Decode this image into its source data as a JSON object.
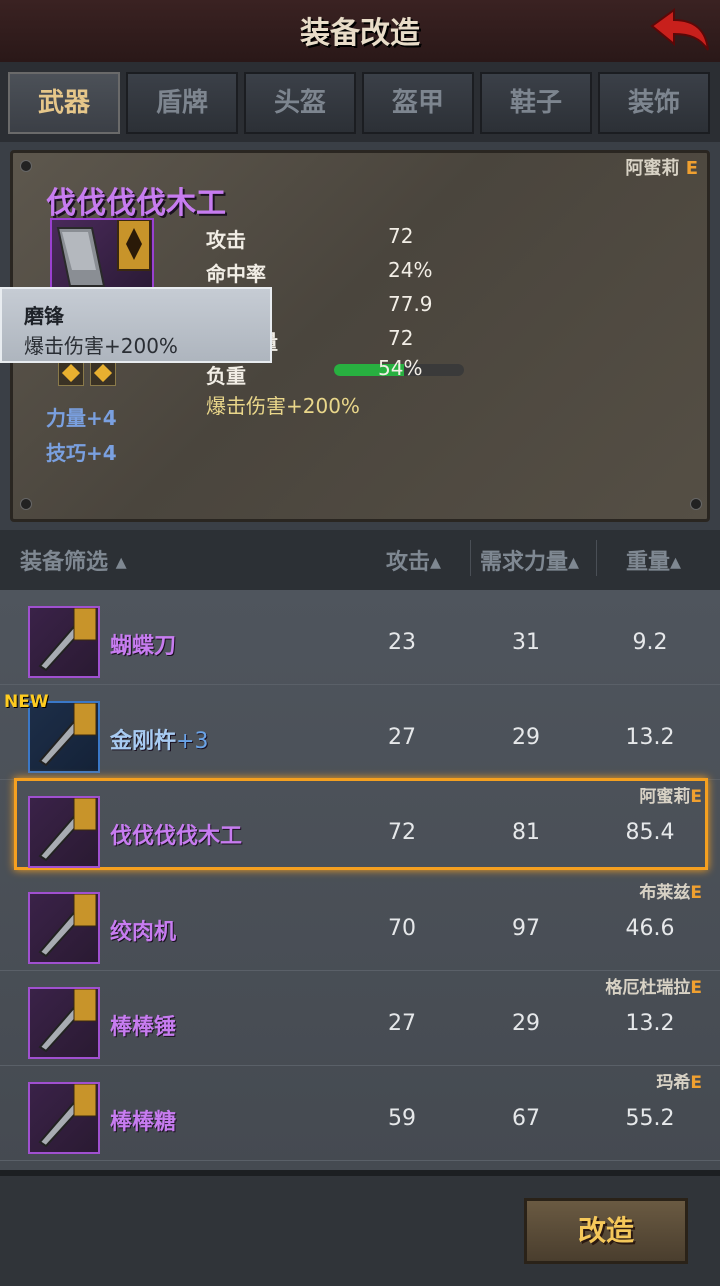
{
  "title": "装备改造",
  "tabs": [
    "武器",
    "盾牌",
    "头盔",
    "盔甲",
    "鞋子",
    "装饰"
  ],
  "active_tab": 0,
  "detail": {
    "owner": "阿蜜莉",
    "grade": "E",
    "name": "伐伐伐伐木工",
    "stats": [
      {
        "label": "攻击",
        "value": "72"
      },
      {
        "label": "命中率",
        "value": "24%"
      },
      {
        "label": "",
        "value": "77.9"
      },
      {
        "label": "量",
        "value": "72"
      },
      {
        "label": "负重",
        "value": "54%"
      }
    ],
    "weight_fraction": 0.54,
    "extra": "爆击伤害+200%",
    "bonus_str": "力量+4",
    "bonus_skill": "技巧+4"
  },
  "tooltip": {
    "title": "磨锋",
    "desc": "爆击伤害+200%"
  },
  "list_header": {
    "filter": "装备筛选",
    "atk": "攻击",
    "req": "需求力量",
    "weight": "重量"
  },
  "items": [
    {
      "name": "蝴蝶刀",
      "plus": "",
      "atk": "23",
      "req": "31",
      "weight": "9.2",
      "owner": "",
      "grade": "",
      "tier": "purple",
      "is_new": false,
      "selected": false
    },
    {
      "name": "金刚杵",
      "plus": "+3",
      "atk": "27",
      "req": "29",
      "weight": "13.2",
      "owner": "",
      "grade": "",
      "tier": "blue",
      "is_new": true,
      "selected": false
    },
    {
      "name": "伐伐伐伐木工",
      "plus": "",
      "atk": "72",
      "req": "81",
      "weight": "85.4",
      "owner": "阿蜜莉",
      "grade": "E",
      "tier": "purple",
      "is_new": false,
      "selected": true
    },
    {
      "name": "绞肉机",
      "plus": "",
      "atk": "70",
      "req": "97",
      "weight": "46.6",
      "owner": "布莱兹",
      "grade": "E",
      "tier": "purple",
      "is_new": false,
      "selected": false
    },
    {
      "name": "棒棒锤",
      "plus": "",
      "atk": "27",
      "req": "29",
      "weight": "13.2",
      "owner": "格厄杜瑞拉",
      "grade": "E",
      "tier": "purple",
      "is_new": false,
      "selected": false
    },
    {
      "name": "棒棒糖",
      "plus": "",
      "atk": "59",
      "req": "67",
      "weight": "55.2",
      "owner": "玛希",
      "grade": "E",
      "tier": "purple",
      "is_new": false,
      "selected": false
    }
  ],
  "new_label": "NEW",
  "modify_button": "改造",
  "colors": {
    "accent": "#f5a020",
    "purple": "#c77cf0",
    "blue_text": "#a8cbf2",
    "grade": "#f0a030"
  }
}
